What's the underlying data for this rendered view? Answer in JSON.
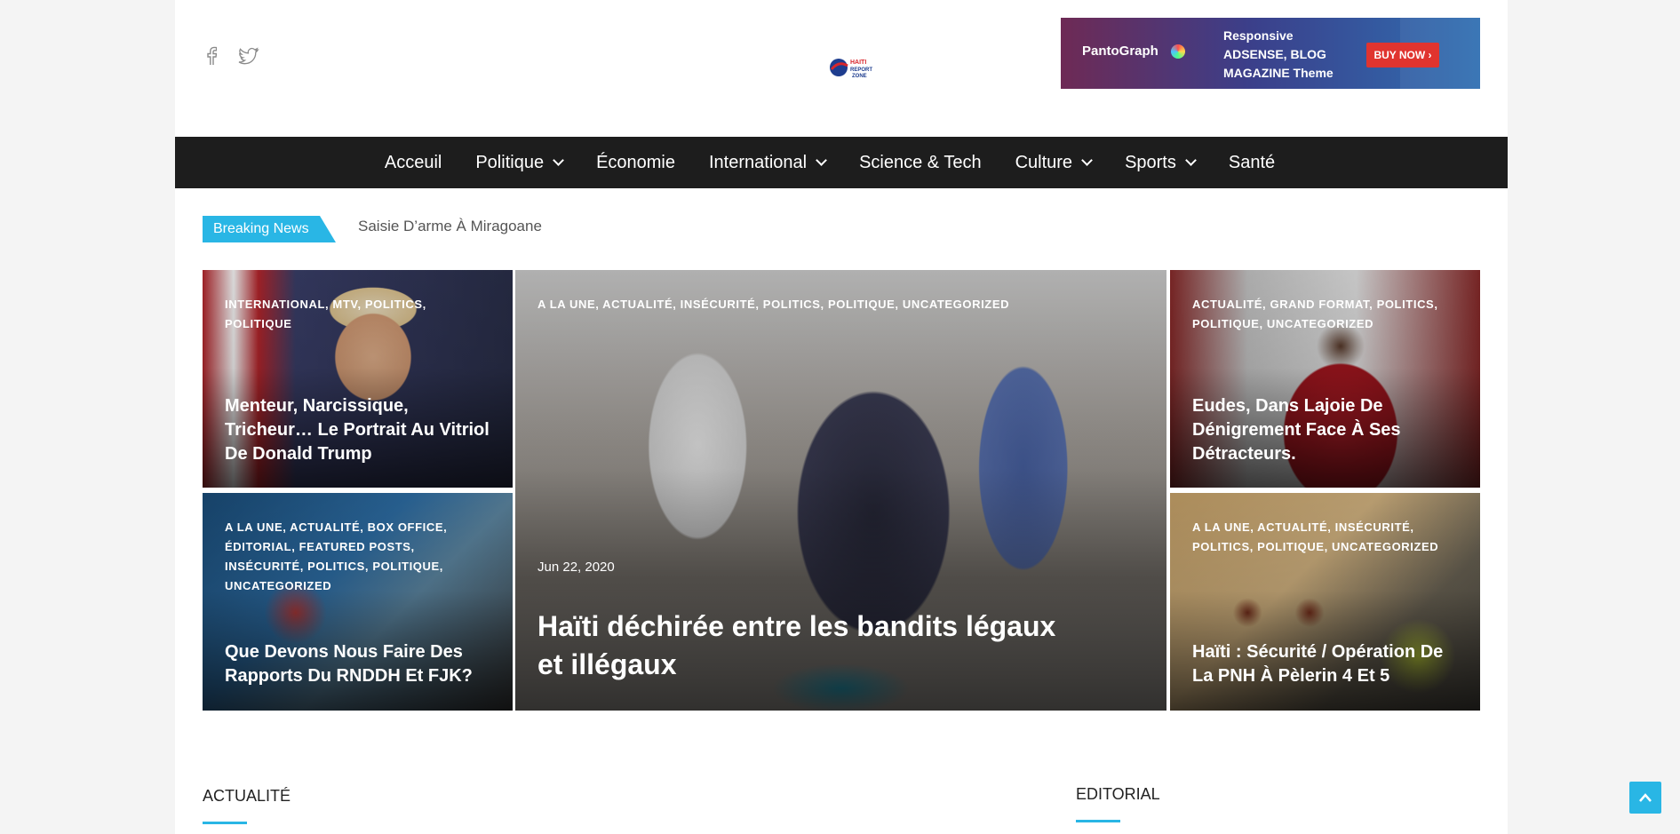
{
  "social": {
    "icons": [
      "facebook-icon",
      "twitter-icon"
    ]
  },
  "logo": {
    "lines": [
      "HAITI",
      "REPORT",
      "ZONE"
    ]
  },
  "ad": {
    "brand": "PantoGraph",
    "lines": [
      "Responsive",
      "ADSENSE, BLOG",
      "MAGAZINE Theme"
    ],
    "button": "BUY NOW"
  },
  "nav": {
    "items": [
      {
        "label": "Acceuil",
        "dropdown": false
      },
      {
        "label": "Politique",
        "dropdown": true
      },
      {
        "label": "Économie",
        "dropdown": false
      },
      {
        "label": "International",
        "dropdown": true
      },
      {
        "label": "Science & Tech",
        "dropdown": false
      },
      {
        "label": "Culture",
        "dropdown": true
      },
      {
        "label": "Sports",
        "dropdown": true
      },
      {
        "label": "Santé",
        "dropdown": false
      }
    ]
  },
  "breaking": {
    "label": "Breaking News",
    "headline": "Saisie D’arme À Miragoane"
  },
  "cards": {
    "trump": {
      "cats": "INTERNATIONAL, MTV, POLITICS, POLITIQUE",
      "title": "Menteur, Narcissique, Tricheur… Le Portrait Au Vitriol De Donald Trump"
    },
    "rnddh": {
      "cats": "A LA UNE, ACTUALITÉ, BOX OFFICE, ÉDITORIAL, FEATURED POSTS, INSÉCURITÉ, POLITICS, POLITIQUE, UNCATEGORIZED",
      "title": "Que Devons Nous Faire Des Rapports Du RNDDH Et FJK?"
    },
    "main": {
      "cats": "A LA UNE, ACTUALITÉ, INSÉCURITÉ, POLITICS, POLITIQUE, UNCATEGORIZED",
      "date": "Jun 22, 2020",
      "title": "Haïti déchirée entre les bandits légaux et illégaux"
    },
    "eudes": {
      "cats": "ACTUALITÉ, GRAND FORMAT, POLITICS, POLITIQUE, UNCATEGORIZED",
      "title": "Eudes, Dans Lajoie De Dénigrement Face À Ses Détracteurs."
    },
    "pnh": {
      "cats": "A LA UNE, ACTUALITÉ, INSÉCURITÉ, POLITICS, POLITIQUE, UNCATEGORIZED",
      "title": "Haïti : Sécurité / Opération De La PNH À Pèlerin 4 Et 5"
    }
  },
  "sections": {
    "left": "ACTUALITÉ",
    "right": "EDITORIAL"
  },
  "colors": {
    "accent": "#29b6e5",
    "nav_bg": "#1d1d1d"
  }
}
